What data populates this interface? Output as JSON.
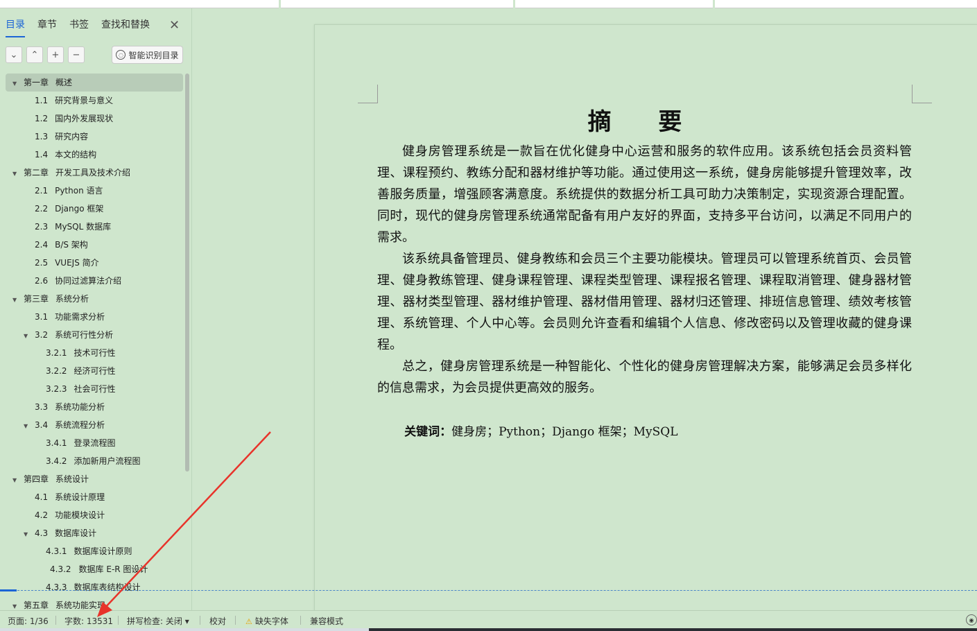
{
  "nav": {
    "tabs": [
      {
        "label": "目录",
        "active": true
      },
      {
        "label": "章节"
      },
      {
        "label": "书签"
      },
      {
        "label": "查找和替换"
      }
    ],
    "close_symbol": "✕",
    "tools": {
      "collapse_symbol": "⌄",
      "expand_symbol": "⌃",
      "add_symbol": "+",
      "remove_symbol": "−",
      "ai_toc_label": "智能识别目录"
    },
    "toc": [
      {
        "num": "第一章",
        "text": "概述",
        "level": 1,
        "expanded": true,
        "selected": true
      },
      {
        "num": "1.1",
        "text": "研究背景与意义",
        "level": 2
      },
      {
        "num": "1.2",
        "text": "国内外发展现状",
        "level": 2
      },
      {
        "num": "1.3",
        "text": "研究内容",
        "level": 2
      },
      {
        "num": "1.4",
        "text": "本文的结构",
        "level": 2
      },
      {
        "num": "第二章",
        "text": "开发工具及技术介绍",
        "level": 1,
        "expanded": true
      },
      {
        "num": "2.1",
        "text": "Python 语言",
        "level": 2
      },
      {
        "num": "2.2",
        "text": "Django 框架",
        "level": 2
      },
      {
        "num": "2.3",
        "text": "MySQL 数据库",
        "level": 2
      },
      {
        "num": "2.4",
        "text": "B/S 架构",
        "level": 2
      },
      {
        "num": "2.5",
        "text": "VUEJS 简介",
        "level": 2
      },
      {
        "num": "2.6",
        "text": "协同过滤算法介绍",
        "level": 2
      },
      {
        "num": "第三章",
        "text": "系统分析",
        "level": 1,
        "expanded": true
      },
      {
        "num": "3.1",
        "text": "功能需求分析",
        "level": 2
      },
      {
        "num": "3.2",
        "text": "系统可行性分析",
        "level": 2,
        "expanded": true
      },
      {
        "num": "3.2.1",
        "text": "技术可行性",
        "level": 3
      },
      {
        "num": "3.2.2",
        "text": "经济可行性",
        "level": 3
      },
      {
        "num": "3.2.3",
        "text": "社会可行性",
        "level": 3
      },
      {
        "num": "3.3",
        "text": "系统功能分析",
        "level": 2
      },
      {
        "num": "3.4",
        "text": "系统流程分析",
        "level": 2,
        "expanded": true
      },
      {
        "num": "3.4.1",
        "text": "登录流程图",
        "level": 3
      },
      {
        "num": "3.4.2",
        "text": "添加新用户流程图",
        "level": 3
      },
      {
        "num": "第四章",
        "text": "系统设计",
        "level": 1,
        "expanded": true
      },
      {
        "num": "4.1",
        "text": "系统设计原理",
        "level": 2
      },
      {
        "num": "4.2",
        "text": "功能模块设计",
        "level": 2
      },
      {
        "num": "4.3",
        "text": "数据库设计",
        "level": 2,
        "expanded": true
      },
      {
        "num": "4.3.1",
        "text": "数据库设计原则",
        "level": 3
      },
      {
        "num": "4.3.2",
        "text": "数据库 E-R 图设计",
        "level": 3,
        "indent_more": true
      },
      {
        "num": "4.3.3",
        "text": "数据库表结构设计",
        "level": 3
      },
      {
        "num": "第五章",
        "text": "系统功能实现",
        "level": 1,
        "expanded": true
      }
    ]
  },
  "document": {
    "title": "摘 要",
    "paragraphs": [
      "健身房管理系统是一款旨在优化健身中心运营和服务的软件应用。该系统包括会员资料管理、课程预约、教练分配和器材维护等功能。通过使用这一系统，健身房能够提升管理效率，改善服务质量，增强顾客满意度。系统提供的数据分析工具可助力决策制定，实现资源合理配置。同时，现代的健身房管理系统通常配备有用户友好的界面，支持多平台访问，以满足不同用户的需求。",
      "该系统具备管理员、健身教练和会员三个主要功能模块。管理员可以管理系统首页、会员管理、健身教练管理、健身课程管理、课程类型管理、课程报名管理、课程取消管理、健身器材管理、器材类型管理、器材维护管理、器材借用管理、器材归还管理、排班信息管理、绩效考核管理、系统管理、个人中心等。会员则允许查看和编辑个人信息、修改密码以及管理收藏的健身课程。",
      "总之，健身房管理系统是一种智能化、个性化的健身房管理解决方案，能够满足会员多样化的信息需求，为会员提供更高效的服务。"
    ],
    "keywords_label": "关键词：",
    "keywords_text": "健身房；Python；Django 框架；MySQL"
  },
  "status_bar": {
    "page": "页面: 1/36",
    "word_count": "字数: 13531",
    "spell_check": "拼写检查: 关闭",
    "spell_dropdown": "▾",
    "proofread": "校对",
    "warn_icon": "⚠",
    "missing_fonts": "缺失字体",
    "compat_mode": "兼容模式",
    "eye_symbol": "◉"
  },
  "colors": {
    "background": "#cfe6cd",
    "accent": "#1c65d6",
    "annotation_arrow": "#e8332a"
  }
}
